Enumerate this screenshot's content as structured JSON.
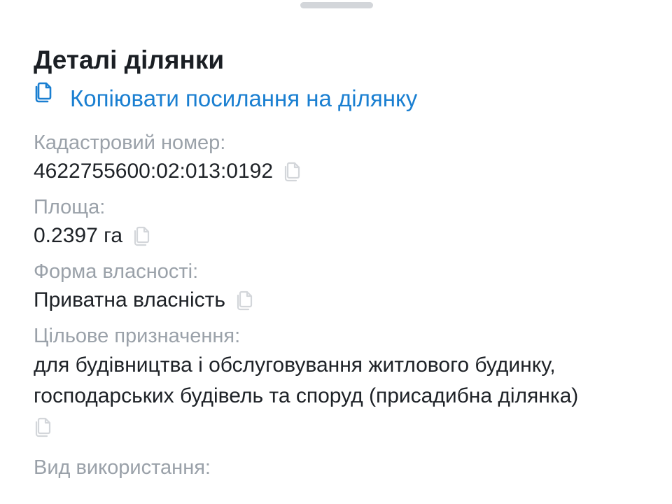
{
  "sheet": {
    "title": "Деталі ділянки",
    "copy_link_label": "Копіювати посилання на ділянку"
  },
  "fields": [
    {
      "label": "Кадастровий номер:",
      "value": "4622755600:02:013:0192"
    },
    {
      "label": "Площа:",
      "value": "0.2397 га"
    },
    {
      "label": "Форма власності:",
      "value": "Приватна власність"
    },
    {
      "label": "Цільове призначення:",
      "value_lines": [
        "для будівництва і обслуговування житлового будинку,",
        "господарських будівель та споруд (присадибна ділянка)"
      ]
    },
    {
      "label": "Вид використання:"
    }
  ],
  "colors": {
    "link": "#1a7fd1",
    "label": "#9aa1a9",
    "value": "#1e2227",
    "copy_icon_faded": "#d3d6da"
  },
  "icons": {
    "link_copy": "copy-icon",
    "value_copy": "copy-icon"
  }
}
